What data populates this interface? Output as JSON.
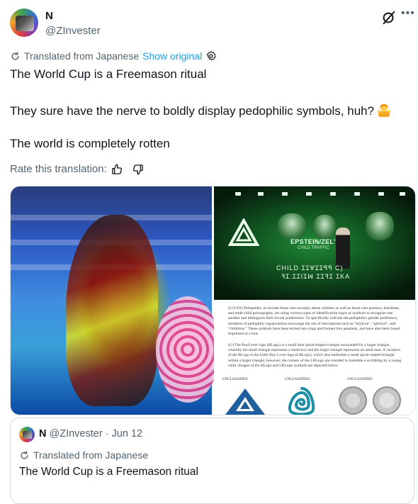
{
  "author": {
    "display_name": "N",
    "handle": "@ZInvester"
  },
  "translation": {
    "notice": "Translated from Japanese",
    "show_original": "Show original"
  },
  "tweet": {
    "line1": "The World Cup is a Freemason ritual",
    "line2": "They sure have the nerve to boldly display pedophilic symbols, huh?",
    "line3": "The world is completely rotten"
  },
  "rate": {
    "label": "Rate this translation:"
  },
  "media": {
    "overlay": {
      "line1": "EPSTEIN/ZEL'",
      "line2": "CHILD TRAFFIC",
      "line3": "CHILD ꞮꞮⱯꞮꞮꟼꟼ C)",
      "line4": "ꟻꞮ.ꞮꞮIꞮꟽ ꞮꞮꟻꞮ ꞮKA"
    },
    "document": {
      "paragraph1": "(U//LES) Pedophiles, to include those who sexually abuse children as well as those who produce, distribute, and trade child pornography, are using various types of identification logos or symbols to recognize one another and distinguish their sexual preferences. To specifically indicate the pedophile's gender preference, members of pedophilic organizations encourage the use of descriptions such as \"boylove\", \"girllove\", and \"childlove.\" These symbols have been etched into rings and formed into pendants, and have also been found imprinted on coins.",
      "paragraph2": "(U) The BoyLover logo (BLogo) is a small blue spiral-shaped triangle surrounded by a larger triangle, whereby the small triangle represents a small boy and the larger triangle represents an adult man. A variation of the BLogo is the Little Boy Lover logo (LBLogo), which also embodies a small spiral-shaped triangle within a larger triangle; however, the corners of the LBLogo are rounded to resemble a scribbling by a young child. Images of the BLogo and LBLogo symbols are depicted below.",
      "unclassified_1": "UNCLASSIFIED",
      "unclassified_2": "UNCLASSIFIED",
      "unclassified_3": "UNCLASSIFIED"
    }
  },
  "quote": {
    "display_name": "N",
    "handle": "@ZInvester",
    "separator": "·",
    "date": "Jun 12",
    "notice": "Translated from Japanese",
    "text": "The World Cup is a Freemason ritual"
  },
  "icons": {
    "grok": "grok-icon",
    "more": "more-dots-icon",
    "translate": "translate-icon",
    "settings": "gear-icon",
    "thumbs_up": "thumbs-up-icon",
    "thumbs_down": "thumbs-down-icon"
  },
  "colors": {
    "link": "#1d9bf0",
    "secondary": "#536471",
    "text": "#0f1419"
  }
}
